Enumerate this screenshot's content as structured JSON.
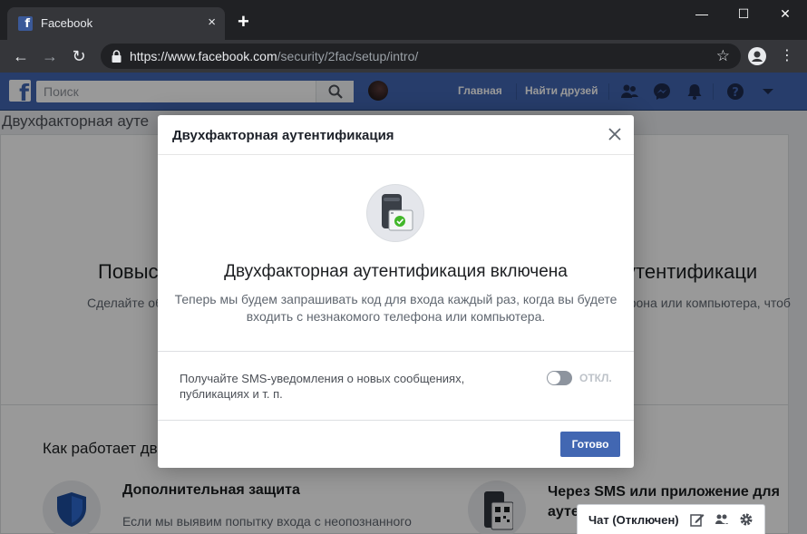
{
  "browser": {
    "tab_title": "Facebook",
    "tab_close": "×",
    "new_tab": "+",
    "url_host": "https://www.facebook.com",
    "url_path": "/security/2fac/setup/intro/",
    "window_minimize": "—",
    "window_maximize": "☐",
    "window_close": "✕",
    "back": "←",
    "forward": "→",
    "reload": "↻",
    "star": "☆",
    "menu": "⋮"
  },
  "fb_header": {
    "logo_letter": "f",
    "search_placeholder": "Поиск",
    "home_label": "Главная",
    "find_friends_label": "Найти друзей",
    "brand_color": "#4267b2"
  },
  "background": {
    "section_title": "Двухфакторная ауте",
    "heading_left": "Повыс",
    "heading_right": "утентификаци",
    "subtitle_left": "Сделайте об",
    "subtitle_right": "фона или компьютера, чтоб",
    "how_it_works": "Как работает дв",
    "feature1_title": "Дополнительная защита",
    "feature1_desc": "Если мы выявим попытку входа с неопознанного",
    "feature2_title": "Через SMS или приложение для ауте"
  },
  "chat": {
    "label": "Чат (Отключен)"
  },
  "modal": {
    "title": "Двухфакторная аутентификация",
    "heading": "Двухфакторная аутентификация включена",
    "description": "Теперь мы будем запрашивать код для входа каждый раз, когда вы будете входить с незнакомого телефона или компьютера.",
    "sms_option": "Получайте SMS-уведомления о новых сообщениях, публикациях и т. п.",
    "toggle_state": "ОТКЛ.",
    "done_button": "Готово"
  }
}
